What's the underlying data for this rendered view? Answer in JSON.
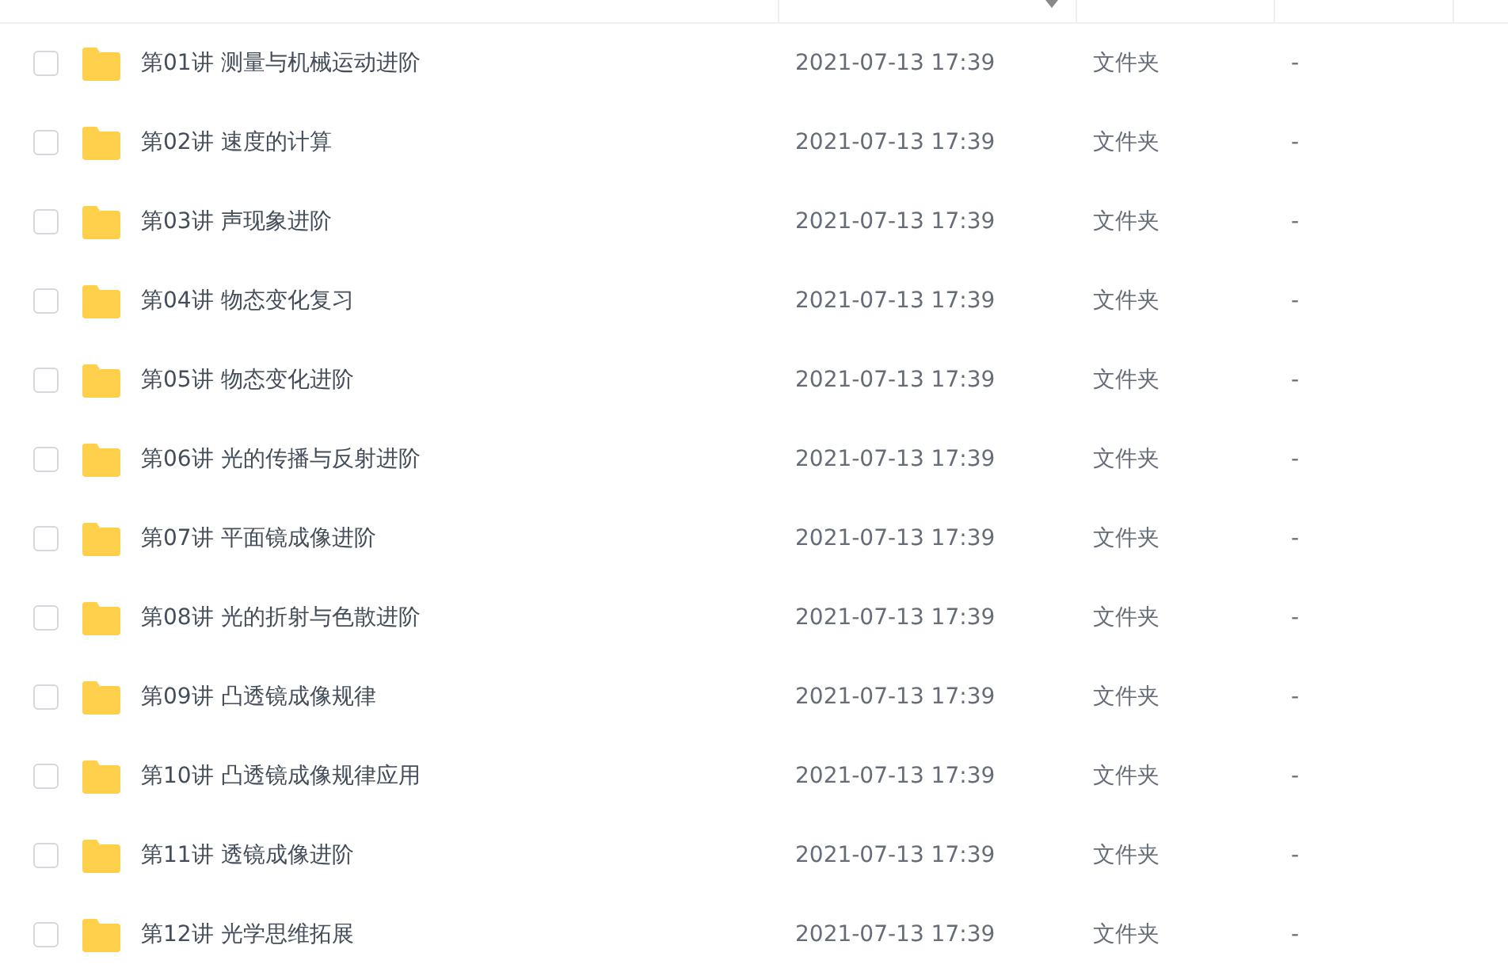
{
  "rows": [
    {
      "name": "第01讲 测量与机械运动进阶",
      "modified": "2021-07-13 17:39",
      "type": "文件夹",
      "size": "-",
      "checked": false
    },
    {
      "name": "第02讲 速度的计算",
      "modified": "2021-07-13 17:39",
      "type": "文件夹",
      "size": "-",
      "checked": false
    },
    {
      "name": "第03讲 声现象进阶",
      "modified": "2021-07-13 17:39",
      "type": "文件夹",
      "size": "-",
      "checked": false
    },
    {
      "name": "第04讲 物态变化复习",
      "modified": "2021-07-13 17:39",
      "type": "文件夹",
      "size": "-",
      "checked": false
    },
    {
      "name": "第05讲 物态变化进阶",
      "modified": "2021-07-13 17:39",
      "type": "文件夹",
      "size": "-",
      "checked": false
    },
    {
      "name": "第06讲 光的传播与反射进阶",
      "modified": "2021-07-13 17:39",
      "type": "文件夹",
      "size": "-",
      "checked": false
    },
    {
      "name": "第07讲 平面镜成像进阶",
      "modified": "2021-07-13 17:39",
      "type": "文件夹",
      "size": "-",
      "checked": false
    },
    {
      "name": "第08讲 光的折射与色散进阶",
      "modified": "2021-07-13 17:39",
      "type": "文件夹",
      "size": "-",
      "checked": false
    },
    {
      "name": "第09讲 凸透镜成像规律",
      "modified": "2021-07-13 17:39",
      "type": "文件夹",
      "size": "-",
      "checked": false
    },
    {
      "name": "第10讲 凸透镜成像规律应用",
      "modified": "2021-07-13 17:39",
      "type": "文件夹",
      "size": "-",
      "checked": false
    },
    {
      "name": "第11讲 透镜成像进阶",
      "modified": "2021-07-13 17:39",
      "type": "文件夹",
      "size": "-",
      "checked": false
    },
    {
      "name": "第12讲 光学思维拓展",
      "modified": "2021-07-13 17:39",
      "type": "文件夹",
      "size": "-",
      "checked": false
    }
  ]
}
